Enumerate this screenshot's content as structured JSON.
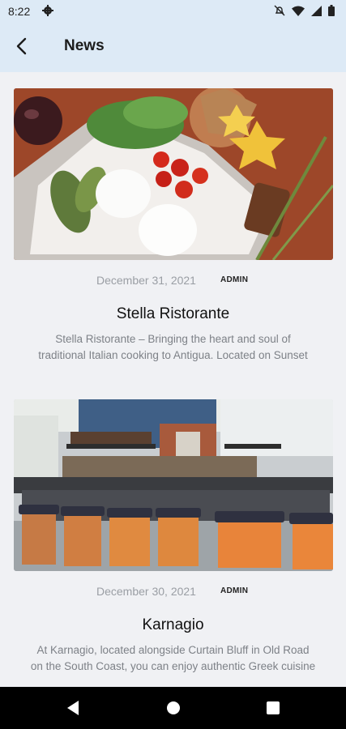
{
  "status": {
    "time": "8:22",
    "icons": [
      "gear-icon",
      "notifications-off-icon",
      "wifi-icon",
      "signal-icon",
      "battery-icon"
    ]
  },
  "appbar": {
    "title": "News",
    "back_icon": "arrow-back-icon"
  },
  "posts": [
    {
      "date": "December 31, 2021",
      "author": "ADMIN",
      "title": "Stella Ristorante",
      "excerpt_lines": [
        "Stella Ristorante – Bringing the heart and soul of",
        "traditional Italian cooking to Antigua. Located on Sunset"
      ],
      "image": "plate of burrata, cherry tomatoes, basil and starfruit"
    },
    {
      "date": "December 30, 2021",
      "author": "ADMIN",
      "title": "Karnagio",
      "excerpt_lines": [
        "At Karnagio, located alongside Curtain Bluff in Old Road",
        "on the South Coast, you can enjoy authentic  Greek cuisine"
      ],
      "image": "bar with liquor shelves and orange wooden stools"
    }
  ],
  "navbar": {
    "buttons": [
      "back-triangle-icon",
      "home-circle-icon",
      "recents-square-icon"
    ]
  },
  "colors": {
    "appbar": "#ddeaf6",
    "background": "#f0f1f4",
    "date": "#9a9ea4",
    "excerpt": "#7d8187"
  }
}
